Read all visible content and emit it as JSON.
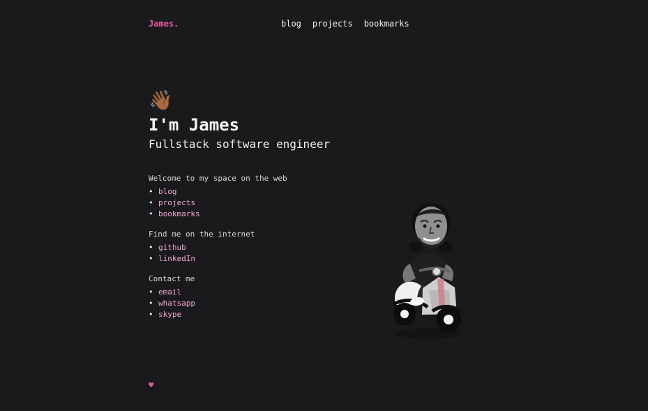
{
  "header": {
    "brand": "James.",
    "nav": [
      "blog",
      "projects",
      "bookmarks"
    ]
  },
  "hero": {
    "wave_emoji": "👋🏾",
    "title": "I'm James",
    "subtitle": "Fullstack software engineer"
  },
  "sections": {
    "welcome": {
      "heading": "Welcome to my space on the web",
      "links": [
        "blog",
        "projects",
        "bookmarks"
      ]
    },
    "internet": {
      "heading": "Find me on the internet",
      "links": [
        "github",
        "linkedIn"
      ]
    },
    "contact": {
      "heading": "Contact me",
      "links": [
        "email",
        "whatsapp",
        "skype"
      ]
    }
  },
  "footer": {
    "heart": "♥"
  },
  "colors": {
    "background": "#1a1a1c",
    "accent": "#e35aa0",
    "link": "#f4a7d3",
    "text": "#e6e6e6"
  },
  "icons": {
    "wave": "waving-hand-icon",
    "heart": "heart-icon",
    "illustration": "scooter-avatar-icon"
  }
}
